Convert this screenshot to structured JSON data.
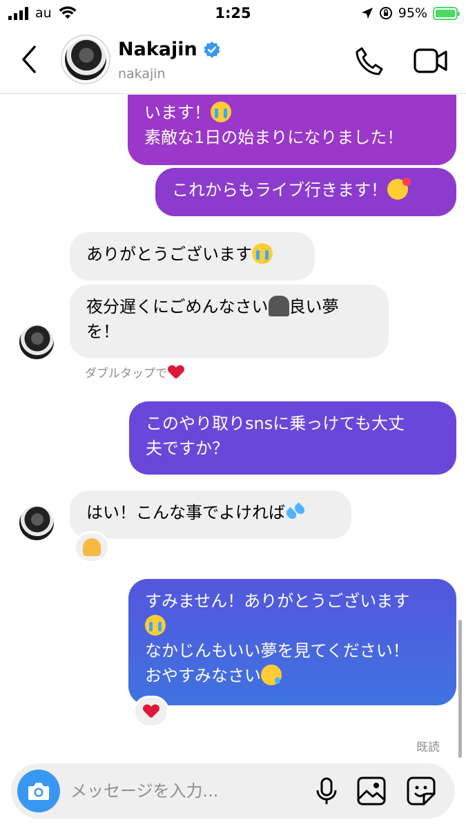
{
  "status": {
    "carrier": "au",
    "time": "1:25",
    "battery": "95%"
  },
  "header": {
    "name": "Nakajin",
    "handle": "nakajin"
  },
  "messages": [
    {
      "id": "m1",
      "side": "out",
      "text": "います！",
      "emoji": "loudly-crying-face",
      "text2": "素敵な1日の始まりになりました！"
    },
    {
      "id": "m2",
      "side": "out",
      "text": "これからもライブ行きます！",
      "emoji": "smiling-face-with-hearts"
    },
    {
      "id": "m3",
      "side": "in",
      "text": "ありがとうございます",
      "emoji": "loudly-crying-face"
    },
    {
      "id": "m4",
      "side": "in",
      "text": "夜分遅くにごめんなさい",
      "emoji": "person-bowing",
      "text2": "良い夢",
      "text3": "を！"
    },
    {
      "id": "m5",
      "side": "out",
      "text": "このやり取りsnsに乗っけても大丈",
      "text2": "夫ですか？"
    },
    {
      "id": "m6",
      "side": "in",
      "text": "はい！こんな事でよければ",
      "emoji": "sweat-droplets",
      "reaction": "folded-hands"
    },
    {
      "id": "m7",
      "side": "out",
      "text": "すみません！ありがとうございます",
      "emoji": "loudly-crying-face",
      "text2": "なかじんもいい夢を見てください！",
      "text3": "おやすみなさい",
      "emoji2": "sleepy-face",
      "reaction": "red-heart"
    }
  ],
  "hint": {
    "text": "ダブルタップで",
    "icon": "red-heart"
  },
  "read_receipt": "既読",
  "composer": {
    "placeholder": "メッセージを入力..."
  },
  "colors": {
    "grad_top": "#9b37c9",
    "grad_mid": "#6d45d8",
    "grad_bottom": "#3f73e0",
    "incoming": "#efefef",
    "accent": "#3897f0"
  }
}
